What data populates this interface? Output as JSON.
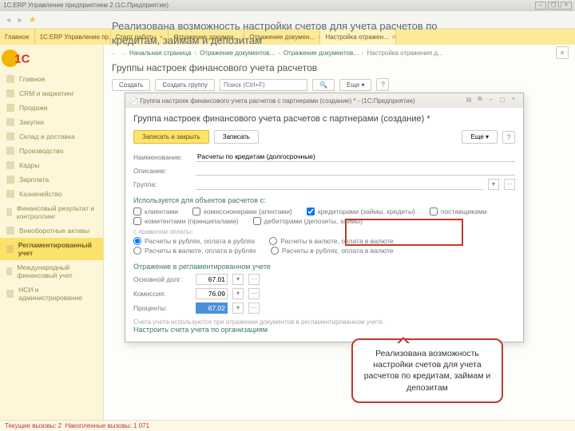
{
  "window": {
    "title": "1С:ERP Управление предприятием 2 (1С:Предприятие)"
  },
  "headline": "Реализована возможность настройки счетов для учета расчетов по кредитам, займам и депозитам",
  "tabs": [
    {
      "label": "Главное"
    },
    {
      "label": "1С:ERP Управление пр..."
    },
    {
      "label": "Старт работы"
    },
    {
      "label": "Отражение докумен..."
    },
    {
      "label": "Отражение докумен..."
    },
    {
      "label": "Настройка отражен..."
    }
  ],
  "sidebar": {
    "items": [
      {
        "label": "Главное"
      },
      {
        "label": "CRM и маркетинг"
      },
      {
        "label": "Продажи"
      },
      {
        "label": "Закупки"
      },
      {
        "label": "Склад и доставка"
      },
      {
        "label": "Производство"
      },
      {
        "label": "Кадры"
      },
      {
        "label": "Зарплата"
      },
      {
        "label": "Казначейство"
      },
      {
        "label": "Финансовый результат и контроллинг"
      },
      {
        "label": "Внеоборотные активы"
      },
      {
        "label": "Регламентированный учет"
      },
      {
        "label": "Международный финансовый учет"
      },
      {
        "label": "НСИ и администрирование"
      }
    ]
  },
  "breadcrumbs": {
    "b1": "Начальная страница",
    "b2": "Отражение документов...",
    "b3": "Отражение документов...",
    "b4": "Настройка отражения д..."
  },
  "page": {
    "title": "Группы настроек финансового учета расчетов",
    "create": "Создать",
    "create_group": "Создать группу",
    "search_ph": "Поиск (Ctrl+F)",
    "more": "Еще ▾"
  },
  "dialog": {
    "titlebar": "Группа настроек финансового учета расчетов с партнерами (создание) * - (1С:Предприятие)",
    "heading": "Группа настроек финансового учета расчетов с партнерами (создание) *",
    "save_close": "Записать и закрыть",
    "save": "Записать",
    "more": "Еще ▾",
    "f_name": "Наименование:",
    "v_name": "Расчеты по кредитам (долгосрочные)",
    "f_descr": "Описание:",
    "f_group": "Группа:",
    "sec_objects": "Используется для объектов расчетов с:",
    "obj": {
      "clients": "клиентами",
      "suppliers": "поставщиками",
      "commissioners": "комиссионерами (агентами)",
      "commitents": "комитентами (принципалами)",
      "creditors": "кредиторами (займы, кредиты)",
      "debtors": "дебиторами (депозиты, займы)"
    },
    "sec_payment": "с правилом оплаты:",
    "pay": {
      "rr": "Расчеты в рублях, оплата в рублях",
      "vr": "Расчеты в валюте, оплата в рублях",
      "vv": "Расчеты в валюте, оплата в валюте",
      "rv": "Расчеты в рублях, оплата в валюте"
    },
    "sec_reg": "Отражение в регламентированном учете",
    "f_main": "Основной долг:",
    "v_main": "67.01",
    "f_comm": "Комиссия:",
    "v_comm": "76.09",
    "f_pct": "Проценты:",
    "v_pct": "67.02",
    "hint": "Счета учета используются при отражении документов в регламентированном учете.",
    "link_org": "Настроить счета учета по организациям"
  },
  "bubble": "Реализована возможность настройки счетов для учета расчетов по кредитам, займам и депозитам",
  "status": {
    "current": "Текущие вызовы: 2",
    "total": "Накопленные вызовы: 1 071"
  }
}
